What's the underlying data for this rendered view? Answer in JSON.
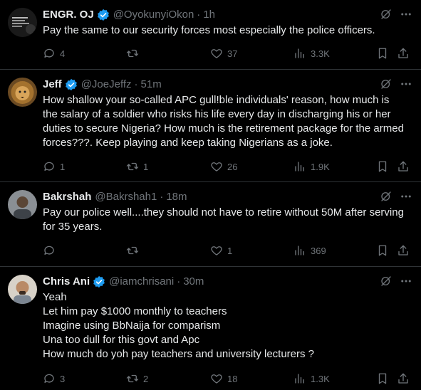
{
  "posts": [
    {
      "name": "ENGR. OJ",
      "verified": true,
      "handle": "@OyokunyiOkon",
      "time": "1h",
      "text": "Pay the same to our security forces most especially the police officers.",
      "replies": "4",
      "reposts": "",
      "likes": "37",
      "views": "3.3K"
    },
    {
      "name": "Jeff",
      "verified": true,
      "handle": "@JoeJeffz",
      "time": "51m",
      "text": "How shallow your so-called APC gull!ble individuals' reason, how much is the salary of a soldier who risks his life every day in discharging his or her duties to secure Nigeria? How much is the retirement package for the armed forces???. Keep playing and keep taking Nigerians as a joke.",
      "replies": "1",
      "reposts": "1",
      "likes": "26",
      "views": "1.9K"
    },
    {
      "name": "Bakrshah",
      "verified": false,
      "handle": "@Bakrshah1",
      "time": "18m",
      "text": "Pay our police well....they should not have to retire without 50M after serving for 35 years.",
      "replies": "",
      "reposts": "",
      "likes": "1",
      "views": "369"
    },
    {
      "name": "Chris Ani",
      "verified": true,
      "handle": "@iamchrisani",
      "time": "30m",
      "text": "Yeah\nLet him pay $1000 monthly to teachers\nImagine using BbNaija for comparism\nUna too dull for this govt and Apc\nHow much do yoh pay teachers and university lecturers ?",
      "replies": "3",
      "reposts": "2",
      "likes": "18",
      "views": "1.3K"
    }
  ],
  "colors": {
    "background": "#000000",
    "text": "#e7e9ea",
    "muted": "#71767b",
    "verified": "#1d9bf0",
    "divider": "#2f3336"
  }
}
